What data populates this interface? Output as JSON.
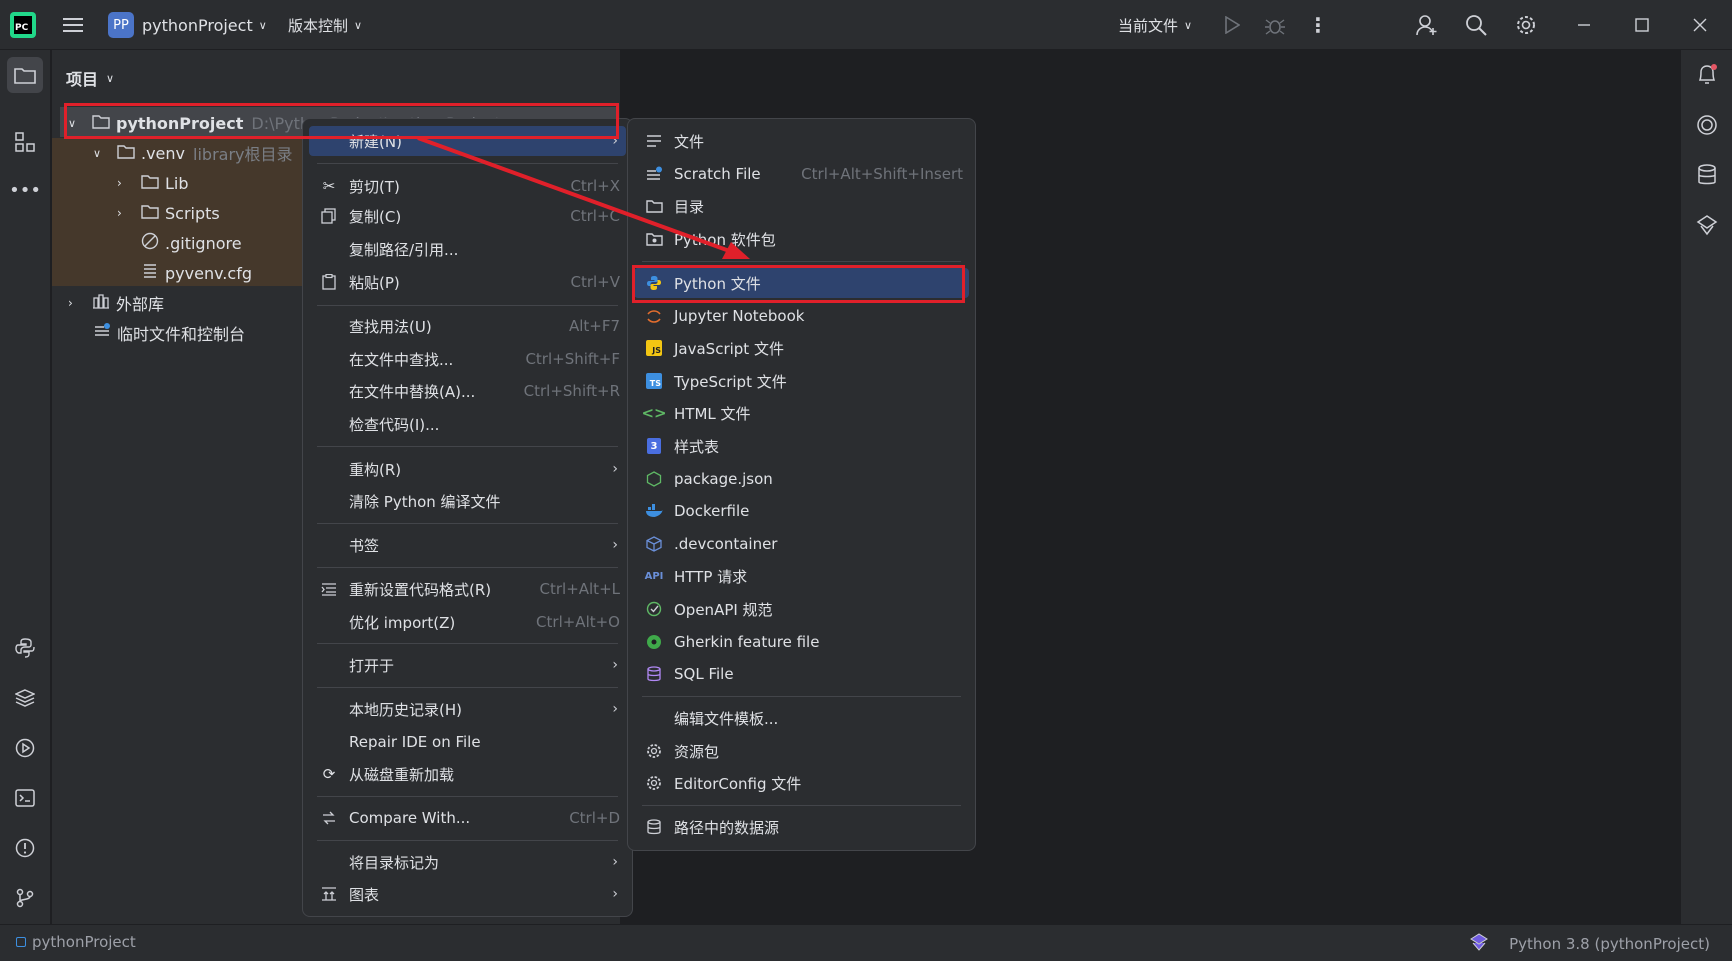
{
  "topbar": {
    "project_badge": "PP",
    "project_name": "pythonProject",
    "vcs": "版本控制",
    "run_config": "当前文件"
  },
  "panel": {
    "title": "项目",
    "tree": [
      {
        "label": "pythonProject",
        "sub": "D:\\PythonProject\\pythonProject"
      },
      {
        "label": ".venv",
        "sub": "library根目录"
      },
      {
        "label": "Lib"
      },
      {
        "label": "Scripts"
      },
      {
        "label": ".gitignore"
      },
      {
        "label": "pyvenv.cfg"
      },
      {
        "label": "外部库"
      },
      {
        "label": "临时文件和控制台"
      }
    ]
  },
  "context_menu": {
    "items": [
      {
        "label": "新建(N)"
      },
      {
        "label": "剪切(T)",
        "shortcut": "Ctrl+X"
      },
      {
        "label": "复制(C)",
        "shortcut": "Ctrl+C"
      },
      {
        "label": "复制路径/引用..."
      },
      {
        "label": "粘贴(P)",
        "shortcut": "Ctrl+V"
      },
      {
        "label": "查找用法(U)",
        "shortcut": "Alt+F7"
      },
      {
        "label": "在文件中查找...",
        "shortcut": "Ctrl+Shift+F"
      },
      {
        "label": "在文件中替换(A)...",
        "shortcut": "Ctrl+Shift+R"
      },
      {
        "label": "检查代码(I)..."
      },
      {
        "label": "重构(R)"
      },
      {
        "label": "清除 Python 编译文件"
      },
      {
        "label": "书签"
      },
      {
        "label": "重新设置代码格式(R)",
        "shortcut": "Ctrl+Alt+L"
      },
      {
        "label": "优化 import(Z)",
        "shortcut": "Ctrl+Alt+O"
      },
      {
        "label": "打开于"
      },
      {
        "label": "本地历史记录(H)"
      },
      {
        "label": "Repair IDE on File"
      },
      {
        "label": "从磁盘重新加载"
      },
      {
        "label": "Compare With...",
        "shortcut": "Ctrl+D"
      },
      {
        "label": "将目录标记为"
      },
      {
        "label": "图表"
      }
    ]
  },
  "submenu": {
    "items": [
      {
        "label": "文件"
      },
      {
        "label": "Scratch File",
        "shortcut": "Ctrl+Alt+Shift+Insert"
      },
      {
        "label": "目录"
      },
      {
        "label": "Python 软件包"
      },
      {
        "label": "Python 文件"
      },
      {
        "label": "Jupyter Notebook"
      },
      {
        "label": "JavaScript 文件"
      },
      {
        "label": "TypeScript 文件"
      },
      {
        "label": "HTML 文件"
      },
      {
        "label": "样式表"
      },
      {
        "label": "package.json"
      },
      {
        "label": "Dockerfile"
      },
      {
        "label": ".devcontainer"
      },
      {
        "label": "HTTP 请求"
      },
      {
        "label": "OpenAPI 规范"
      },
      {
        "label": "Gherkin feature file"
      },
      {
        "label": "SQL File"
      },
      {
        "label": "编辑文件模板..."
      },
      {
        "label": "资源包"
      },
      {
        "label": "EditorConfig 文件"
      },
      {
        "label": "路径中的数据源"
      }
    ]
  },
  "status": {
    "project": "pythonProject",
    "interpreter": "Python 3.8 (pythonProject)"
  },
  "colors": {
    "accent": "#2e436e",
    "highlight": "#e0202a"
  }
}
